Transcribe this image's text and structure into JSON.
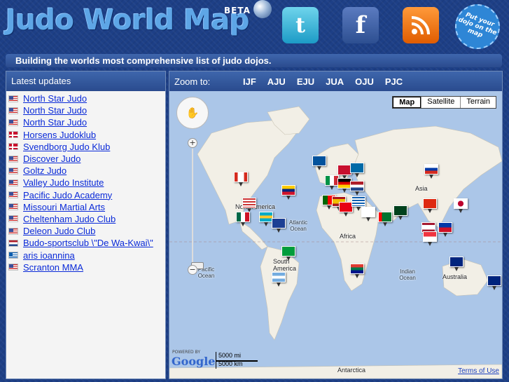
{
  "header": {
    "logo_text": "Judo World Map",
    "beta_label": "BETA",
    "badge_text": "Put your dojo on the map",
    "tagline": "Building the worlds most comprehensive list of judo dojos."
  },
  "social": {
    "twitter_icon": "twitter-icon",
    "facebook_icon": "facebook-icon",
    "rss_icon": "rss-icon"
  },
  "latest": {
    "title": "Latest updates",
    "items": [
      {
        "flag": "us",
        "name": "North Star Judo"
      },
      {
        "flag": "us",
        "name": "North Star Judo"
      },
      {
        "flag": "us",
        "name": "North Star Judo"
      },
      {
        "flag": "dk",
        "name": "Horsens Judoklub"
      },
      {
        "flag": "dk",
        "name": "Svendborg Judo Klub"
      },
      {
        "flag": "us",
        "name": "Discover Judo"
      },
      {
        "flag": "us",
        "name": "Goltz Judo"
      },
      {
        "flag": "us",
        "name": "Valley Judo Institute"
      },
      {
        "flag": "us",
        "name": "Pacific Judo Academy"
      },
      {
        "flag": "us",
        "name": "Missouri Martial Arts"
      },
      {
        "flag": "us",
        "name": "Cheltenham Judo Club"
      },
      {
        "flag": "us",
        "name": "Deleon Judo Club"
      },
      {
        "flag": "nl",
        "name": "Budo-sportsclub \\\"De Wa-Kwai\\\""
      },
      {
        "flag": "gr",
        "name": "aris ioannina"
      },
      {
        "flag": "us",
        "name": "Scranton MMA"
      }
    ]
  },
  "map": {
    "zoom_label": "Zoom to:",
    "zoom_links": [
      "IJF",
      "AJU",
      "EJU",
      "JUA",
      "OJU",
      "PJC"
    ],
    "map_types": [
      "Map",
      "Satellite",
      "Terrain"
    ],
    "selected_type": "Map",
    "labels": {
      "north_america": "North America",
      "atlantic": "Atlantic Ocean",
      "pacific": "Pacific Ocean",
      "south_america": "South America",
      "africa": "Africa",
      "asia": "Asia",
      "indian": "Indian Ocean",
      "australia": "Australia",
      "antarctica": "Antarctica"
    },
    "scale_mi": "5000 mi",
    "scale_km": "5000 km",
    "powered_by": "POWERED BY",
    "google": "Google",
    "terms": "Terms of Use"
  },
  "colors": {
    "background": "#1d3f86",
    "panel_header": "#2a4b8e",
    "link": "#0a2ad8",
    "water": "#abc6e8",
    "land": "#f2efe6"
  }
}
